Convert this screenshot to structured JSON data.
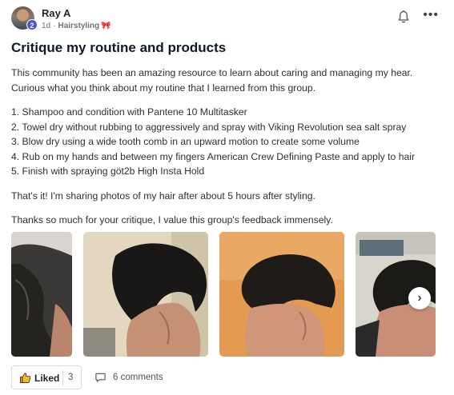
{
  "post": {
    "author": "Ray A",
    "avatar_badge": "2",
    "time": "1d",
    "separator": "·",
    "group": "Hairstyling",
    "group_icon": "ribbon-icon",
    "title": "Critique my routine and products",
    "intro_line1": "This community has been an amazing resource to learn about caring and managing my hear.",
    "intro_line2": "Curious what you think about my routine that I learned from this group.",
    "steps": [
      "1. Shampoo and condition with Pantene 10 Multitasker",
      "2. Towel dry without rubbing to aggressively and spray with Viking Revolution sea salt spray",
      "3. Blow dry using a wide tooth comb in an upward motion to create some volume",
      "4. Rub on my hands and between my fingers American Crew Defining Paste and apply to hair",
      "5. Finish with spraying göt2b High Insta Hold"
    ],
    "closing": "That's it! I'm sharing photos of my hair after about 5 hours after styling.",
    "thanks": "Thanks so much for your critique, I value this group's feedback immensely."
  },
  "actions": {
    "like_label": "Liked",
    "like_count": "3",
    "comments_label": "6 comments"
  },
  "icons": {
    "bell": "bell-icon",
    "more": "more-options-icon",
    "like": "thumbs-up-icon",
    "comment": "comment-icon",
    "next": "chevron-right-icon"
  },
  "colors": {
    "avatar_badge": "#4a57c8",
    "ribbon": "#e0466a",
    "like_icon": "#e8a317"
  }
}
